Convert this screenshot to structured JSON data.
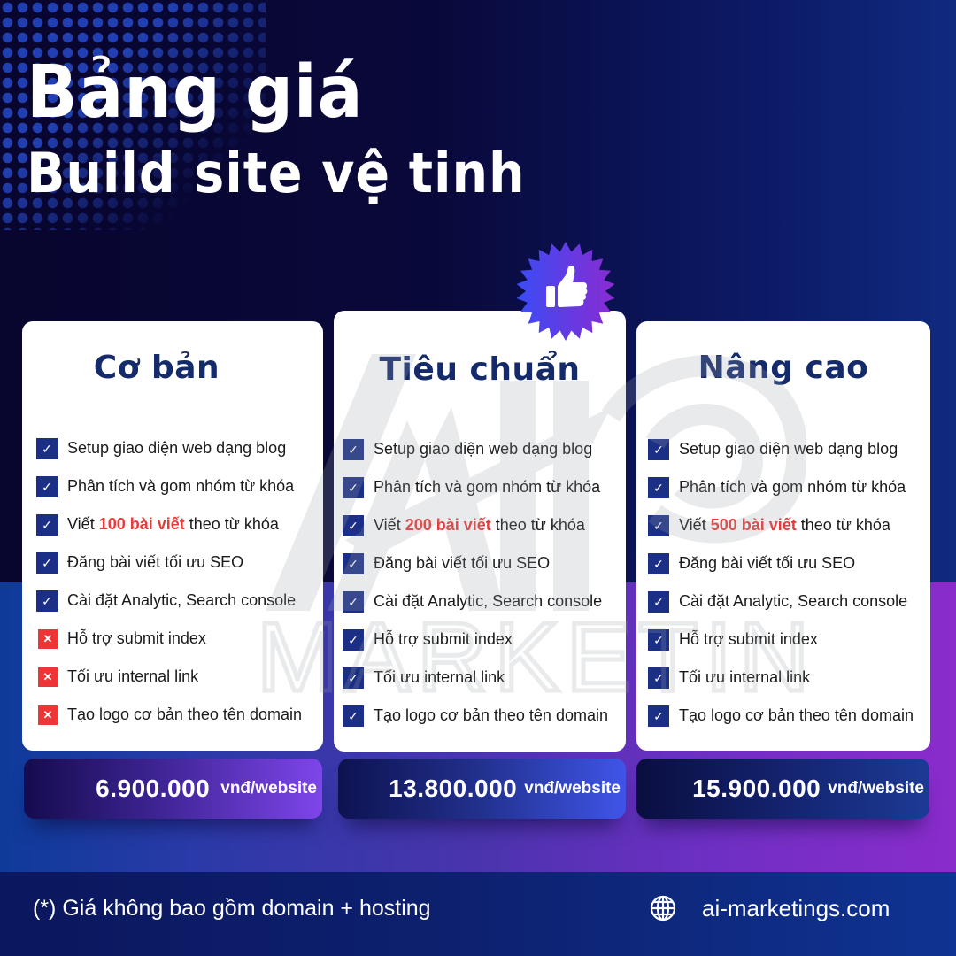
{
  "header": {
    "title_line1": "Bảng giá",
    "title_line2": "Build site vệ tinh"
  },
  "watermark": {
    "text": "MARKETING",
    "logo": "AI"
  },
  "badge": {
    "icon": "thumbs-up-icon"
  },
  "colors": {
    "brand_navy": "#152a6b",
    "check_blue": "#1c2f86",
    "cross_red": "#ee3434",
    "highlight_red": "#e83a3a"
  },
  "plans": [
    {
      "name": "Cơ bản",
      "features": [
        {
          "pre": "Setup giao diện web dạng blog",
          "hl": "",
          "post": "",
          "included": true
        },
        {
          "pre": "Phân tích và gom nhóm từ khóa",
          "hl": "",
          "post": "",
          "included": true
        },
        {
          "pre": "Viết ",
          "hl": "100 bài viết",
          "post": " theo từ khóa",
          "included": true
        },
        {
          "pre": "Đăng bài viết tối ưu SEO",
          "hl": "",
          "post": "",
          "included": true
        },
        {
          "pre": "Cài đặt Analytic, Search console",
          "hl": "",
          "post": "",
          "included": true
        },
        {
          "pre": "Hỗ trợ submit index",
          "hl": "",
          "post": "",
          "included": false
        },
        {
          "pre": "Tối ưu internal link",
          "hl": "",
          "post": "",
          "included": false
        },
        {
          "pre": "Tạo logo cơ bản theo tên domain",
          "hl": "",
          "post": "",
          "included": false
        }
      ],
      "price": "6.900.000",
      "unit": "vnđ/website"
    },
    {
      "name": "Tiêu chuẩn",
      "features": [
        {
          "pre": "Setup giao diện web dạng blog",
          "hl": "",
          "post": "",
          "included": true
        },
        {
          "pre": "Phân tích và gom nhóm từ khóa",
          "hl": "",
          "post": "",
          "included": true
        },
        {
          "pre": "Viết ",
          "hl": "200 bài viết",
          "post": " theo từ khóa",
          "included": true
        },
        {
          "pre": "Đăng bài viết tối ưu SEO",
          "hl": "",
          "post": "",
          "included": true
        },
        {
          "pre": "Cài đặt Analytic, Search console",
          "hl": "",
          "post": "",
          "included": true
        },
        {
          "pre": "Hỗ trợ submit index",
          "hl": "",
          "post": "",
          "included": true
        },
        {
          "pre": "Tối ưu internal link",
          "hl": "",
          "post": "",
          "included": true
        },
        {
          "pre": "Tạo logo cơ bản theo tên domain",
          "hl": "",
          "post": "",
          "included": true
        }
      ],
      "price": "13.800.000",
      "unit": "vnđ/website"
    },
    {
      "name": "Nâng cao",
      "features": [
        {
          "pre": "Setup giao diện web dạng blog",
          "hl": "",
          "post": "",
          "included": true
        },
        {
          "pre": "Phân tích và gom nhóm từ khóa",
          "hl": "",
          "post": "",
          "included": true
        },
        {
          "pre": "Viết ",
          "hl": "500 bài viết",
          "post": " theo từ khóa",
          "included": true
        },
        {
          "pre": "Đăng bài viết tối ưu SEO",
          "hl": "",
          "post": "",
          "included": true
        },
        {
          "pre": "Cài đặt Analytic, Search console",
          "hl": "",
          "post": "",
          "included": true
        },
        {
          "pre": "Hỗ trợ submit index",
          "hl": "",
          "post": "",
          "included": true
        },
        {
          "pre": "Tối ưu internal link",
          "hl": "",
          "post": "",
          "included": true
        },
        {
          "pre": "Tạo logo cơ bản theo tên domain",
          "hl": "",
          "post": "",
          "included": true
        }
      ],
      "price": "15.900.000",
      "unit": "vnđ/website"
    }
  ],
  "footer": {
    "note": "(*) Giá không bao gồm domain + hosting",
    "website": "ai-marketings.com",
    "website_icon": "globe-icon"
  }
}
